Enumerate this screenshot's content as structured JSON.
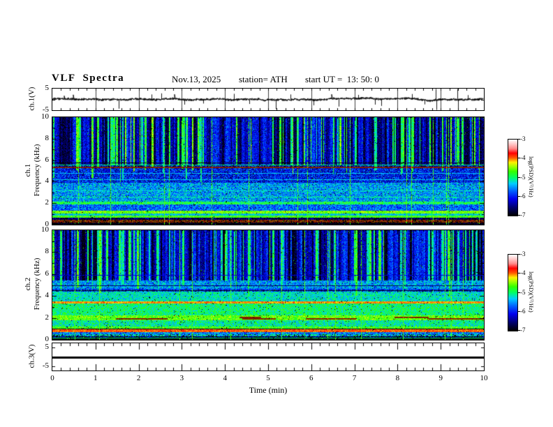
{
  "header": {
    "title": "VLF  Spectra",
    "date": "Nov.13, 2025",
    "station": "station= ATH",
    "start_ut": "start UT =  13: 50: 0"
  },
  "xaxis": {
    "label": "Time  (min)",
    "ticks": [
      "0",
      "1",
      "2",
      "3",
      "4",
      "5",
      "6",
      "7",
      "8",
      "9",
      "10"
    ],
    "xlim": [
      0,
      10
    ]
  },
  "colorbar": {
    "label": "log(PSD)(V²/Hz)",
    "ticks": [
      "-3",
      "-4",
      "-5",
      "-6",
      "-7"
    ],
    "zlim": [
      -7,
      -3
    ],
    "stops": [
      {
        "t": 0.0,
        "c": "#000000"
      },
      {
        "t": 0.1,
        "c": "#000066"
      },
      {
        "t": 0.22,
        "c": "#0000ee"
      },
      {
        "t": 0.33,
        "c": "#0066ff"
      },
      {
        "t": 0.42,
        "c": "#00ccff"
      },
      {
        "t": 0.5,
        "c": "#00ff66"
      },
      {
        "t": 0.58,
        "c": "#33ff00"
      },
      {
        "t": 0.65,
        "c": "#aaff00"
      },
      {
        "t": 0.7,
        "c": "#ffee00"
      },
      {
        "t": 0.76,
        "c": "#ff5500"
      },
      {
        "t": 0.82,
        "c": "#ff0000"
      },
      {
        "t": 0.88,
        "c": "#ff8888"
      },
      {
        "t": 0.94,
        "c": "#ffc8c8"
      },
      {
        "t": 1.0,
        "c": "#ffffff"
      }
    ]
  },
  "panels": {
    "ch1_wave": {
      "ylabel": "ch.1(V)",
      "ytick_top": "5",
      "ytick_bottom": "-5",
      "ylim": [
        -5,
        5
      ]
    },
    "ch1_spec": {
      "ylabel_ch": "ch.1",
      "ylabel_axis": "Frequency  (kHz)",
      "yticks": [
        10,
        8,
        6,
        4,
        2,
        0
      ],
      "ylim": [
        0,
        10
      ]
    },
    "ch2_spec": {
      "ylabel_ch": "ch.2",
      "ylabel_axis": "Frequency  (kHz)",
      "yticks": [
        10,
        8,
        6,
        4,
        2,
        0
      ],
      "ylim": [
        0,
        10
      ]
    },
    "ch3_wave": {
      "ylabel": "ch.3(V)",
      "ytick_top": "5",
      "ytick_bottom": "-5",
      "ylim": [
        -7,
        7
      ]
    }
  },
  "chart_data": [
    {
      "type": "line",
      "name": "ch.1 waveform",
      "xlim": [
        0,
        10
      ],
      "ylim": [
        -5,
        5
      ],
      "baseline_v": 0,
      "noise_amplitude_v": 0.8,
      "spikes": [
        {
          "t": 1.53,
          "v": -4.3
        },
        {
          "t": 2.3,
          "v": 2.3
        },
        {
          "t": 2.52,
          "v": 2.8
        },
        {
          "t": 3.06,
          "v": -2.4
        },
        {
          "t": 3.5,
          "v": -1.9
        },
        {
          "t": 4.2,
          "v": 2.6
        },
        {
          "t": 4.57,
          "v": -2.1
        },
        {
          "t": 5.18,
          "v": -4.5
        },
        {
          "t": 5.52,
          "v": 2.3
        },
        {
          "t": 6.05,
          "v": -2.7
        },
        {
          "t": 6.63,
          "v": -3.3
        },
        {
          "t": 7.08,
          "v": 2.1
        },
        {
          "t": 7.47,
          "v": -2.4
        },
        {
          "t": 7.62,
          "v": -3.0
        },
        {
          "t": 8.33,
          "v": 2.5
        },
        {
          "t": 8.62,
          "v": -2.3
        },
        {
          "t": 8.88,
          "v": 4.9
        },
        {
          "t": 8.9,
          "v": -4.9
        },
        {
          "t": 9.38,
          "v": 4.8
        },
        {
          "t": 9.4,
          "v": -4.7
        },
        {
          "t": 9.62,
          "v": 2.0
        }
      ]
    },
    {
      "type": "heatmap",
      "name": "ch.1 spectrogram",
      "xlim": [
        0,
        10
      ],
      "ylim": [
        0,
        10
      ],
      "zlabel": "log(PSD)(V²/Hz)",
      "zlim": [
        -7,
        -3
      ],
      "bands": [
        {
          "f": [
            0.0,
            0.2
          ],
          "l": -6.9,
          "v": 0.3,
          "black": 0.3
        },
        {
          "f": [
            0.2,
            0.45
          ],
          "l": -3.9,
          "v": 0.3,
          "mul": 0.55,
          "black": 0.25
        },
        {
          "f": [
            0.45,
            0.62
          ],
          "l": -6.6,
          "v": 0.5,
          "black": 0.2
        },
        {
          "f": [
            0.62,
            0.82
          ],
          "l": -4.7,
          "v": 0.35
        },
        {
          "f": [
            0.82,
            1.05
          ],
          "l": -5.3,
          "v": 0.4
        },
        {
          "f": [
            1.05,
            1.3
          ],
          "l": -4.55,
          "v": 0.3
        },
        {
          "f": [
            1.3,
            1.9
          ],
          "l": -5.7,
          "v": 0.5
        },
        {
          "f": [
            1.9,
            2.15
          ],
          "l": -4.9,
          "v": 0.4
        },
        {
          "f": [
            2.15,
            3.9
          ],
          "l": -5.5,
          "v": 0.5
        },
        {
          "f": [
            3.9,
            5.3
          ],
          "l": -6.05,
          "v": 0.6
        },
        {
          "f": [
            5.3,
            5.55
          ],
          "l": -6.3,
          "v": 0.8
        },
        {
          "f": [
            5.55,
            10.0
          ],
          "streak": true
        }
      ],
      "hlines": [
        {
          "f": 2.6,
          "l": -5.1
        },
        {
          "f": 3.15,
          "l": -5.2
        },
        {
          "f": 4.25,
          "l": -5.3
        },
        {
          "f": 4.8,
          "l": -5.35
        },
        {
          "f": 5.42,
          "l": -3.9,
          "mul": 0.5
        },
        {
          "f": 5.6,
          "l": -5.0
        },
        {
          "f": 5.78,
          "l": -6.9
        }
      ],
      "vlines": [
        1.35,
        2.7,
        4.55,
        6.9,
        8.2
      ],
      "streaks": {
        "f": [
          5.55,
          10
        ],
        "dark_prob": 0.1,
        "bright_prob": 0.32,
        "dark_l": -6.95,
        "bright_l": -4.85,
        "base_l": -6.3
      }
    },
    {
      "type": "heatmap",
      "name": "ch.2 spectrogram",
      "xlim": [
        0,
        10
      ],
      "ylim": [
        0,
        10
      ],
      "zlabel": "log(PSD)(V²/Hz)",
      "zlim": [
        -7,
        -3
      ],
      "bands": [
        {
          "f": [
            0.0,
            0.12
          ],
          "l": -7.0,
          "v": 0.2
        },
        {
          "f": [
            0.12,
            0.3
          ],
          "l": -6.5,
          "v": 0.5,
          "black": 0.3
        },
        {
          "f": [
            0.3,
            0.5
          ],
          "l": -5.3,
          "v": 0.6,
          "black": 0.2
        },
        {
          "f": [
            0.5,
            0.68
          ],
          "l": -5.6,
          "v": 0.5
        },
        {
          "f": [
            0.68,
            0.95
          ],
          "l": -3.95,
          "v": 0.2
        },
        {
          "f": [
            0.95,
            1.2
          ],
          "l": -4.7,
          "v": 0.35
        },
        {
          "f": [
            1.2,
            1.8
          ],
          "l": -5.1,
          "v": 0.45
        },
        {
          "f": [
            1.8,
            2.25
          ],
          "l": -4.6,
          "v": 0.35
        },
        {
          "f": [
            2.25,
            3.3
          ],
          "l": -5.0,
          "v": 0.4
        },
        {
          "f": [
            3.3,
            3.5
          ],
          "l": -4.05,
          "v": 0.2
        },
        {
          "f": [
            3.5,
            4.4
          ],
          "l": -5.2,
          "v": 0.4
        },
        {
          "f": [
            4.4,
            4.6
          ],
          "l": -5.9,
          "v": 0.7
        },
        {
          "f": [
            4.6,
            5.4
          ],
          "l": -5.5,
          "v": 0.5
        },
        {
          "f": [
            5.4,
            10.0
          ],
          "streak": true
        }
      ],
      "hlines": [
        {
          "f": 0.2,
          "l": -5.0
        },
        {
          "f": 1.05,
          "l": -6.9
        },
        {
          "f": 2.0,
          "l": -3.9,
          "mul": 0.5,
          "dash": true
        },
        {
          "f": 2.12,
          "l": -3.9,
          "mul": 0.5,
          "dash": true
        },
        {
          "f": 4.5,
          "l": -6.9
        },
        {
          "f": 4.62,
          "l": -5.9
        },
        {
          "f": 5.0,
          "l": -6.6
        },
        {
          "f": 5.9,
          "l": -6.2
        }
      ],
      "vlines": [
        1.08,
        2.95,
        5.3,
        6.55,
        9.1
      ],
      "streaks": {
        "f": [
          5.4,
          10
        ],
        "dark_prob": 0.16,
        "bright_prob": 0.24,
        "dark_l": -7.0,
        "bright_l": -5.0,
        "base_l": -6.2
      }
    },
    {
      "type": "line",
      "name": "ch.3 waveform",
      "xlim": [
        0,
        10
      ],
      "ylim": [
        -7,
        7
      ],
      "constant_v": 0
    }
  ]
}
